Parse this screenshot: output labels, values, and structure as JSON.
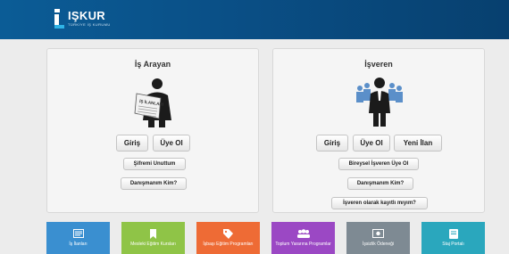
{
  "header": {
    "logo_name": "IŞKUR",
    "logo_subtitle": "TÜRKİYE İŞ KURUMU"
  },
  "job_seeker": {
    "title": "İş Arayan",
    "newspaper_text": "İŞ İLANLARI",
    "login_label": "Giriş",
    "register_label": "Üye Ol",
    "forgot_password_label": "Şifremi Unuttum",
    "counselor_label": "Danışmanım Kim?"
  },
  "employer": {
    "title": "İşveren",
    "login_label": "Giriş",
    "register_label": "Üye Ol",
    "new_ad_label": "Yeni İlan",
    "individual_employer_label": "Bireysel İşveren Üye Ol",
    "counselor_label": "Danışmanım Kim?",
    "registered_check_label": "İşveren olarak kayıtlı mıyım?"
  },
  "tiles": [
    {
      "label": "İş İlanları",
      "color": "#3a8fd0",
      "icon": "list-icon"
    },
    {
      "label": "Mesleki Eğitim Kursları",
      "color": "#8fc447",
      "icon": "bookmark-icon"
    },
    {
      "label": "İşbaşı Eğitim Programları",
      "color": "#ee6b35",
      "icon": "tag-icon"
    },
    {
      "label": "Toplum Yararına Programlar",
      "color": "#9b48c4",
      "icon": "group-icon"
    },
    {
      "label": "İşsizlik Ödeneği",
      "color": "#7e8a93",
      "icon": "money-icon"
    },
    {
      "label": "Staj Portalı",
      "color": "#2aa7bd",
      "icon": "book-icon"
    }
  ]
}
